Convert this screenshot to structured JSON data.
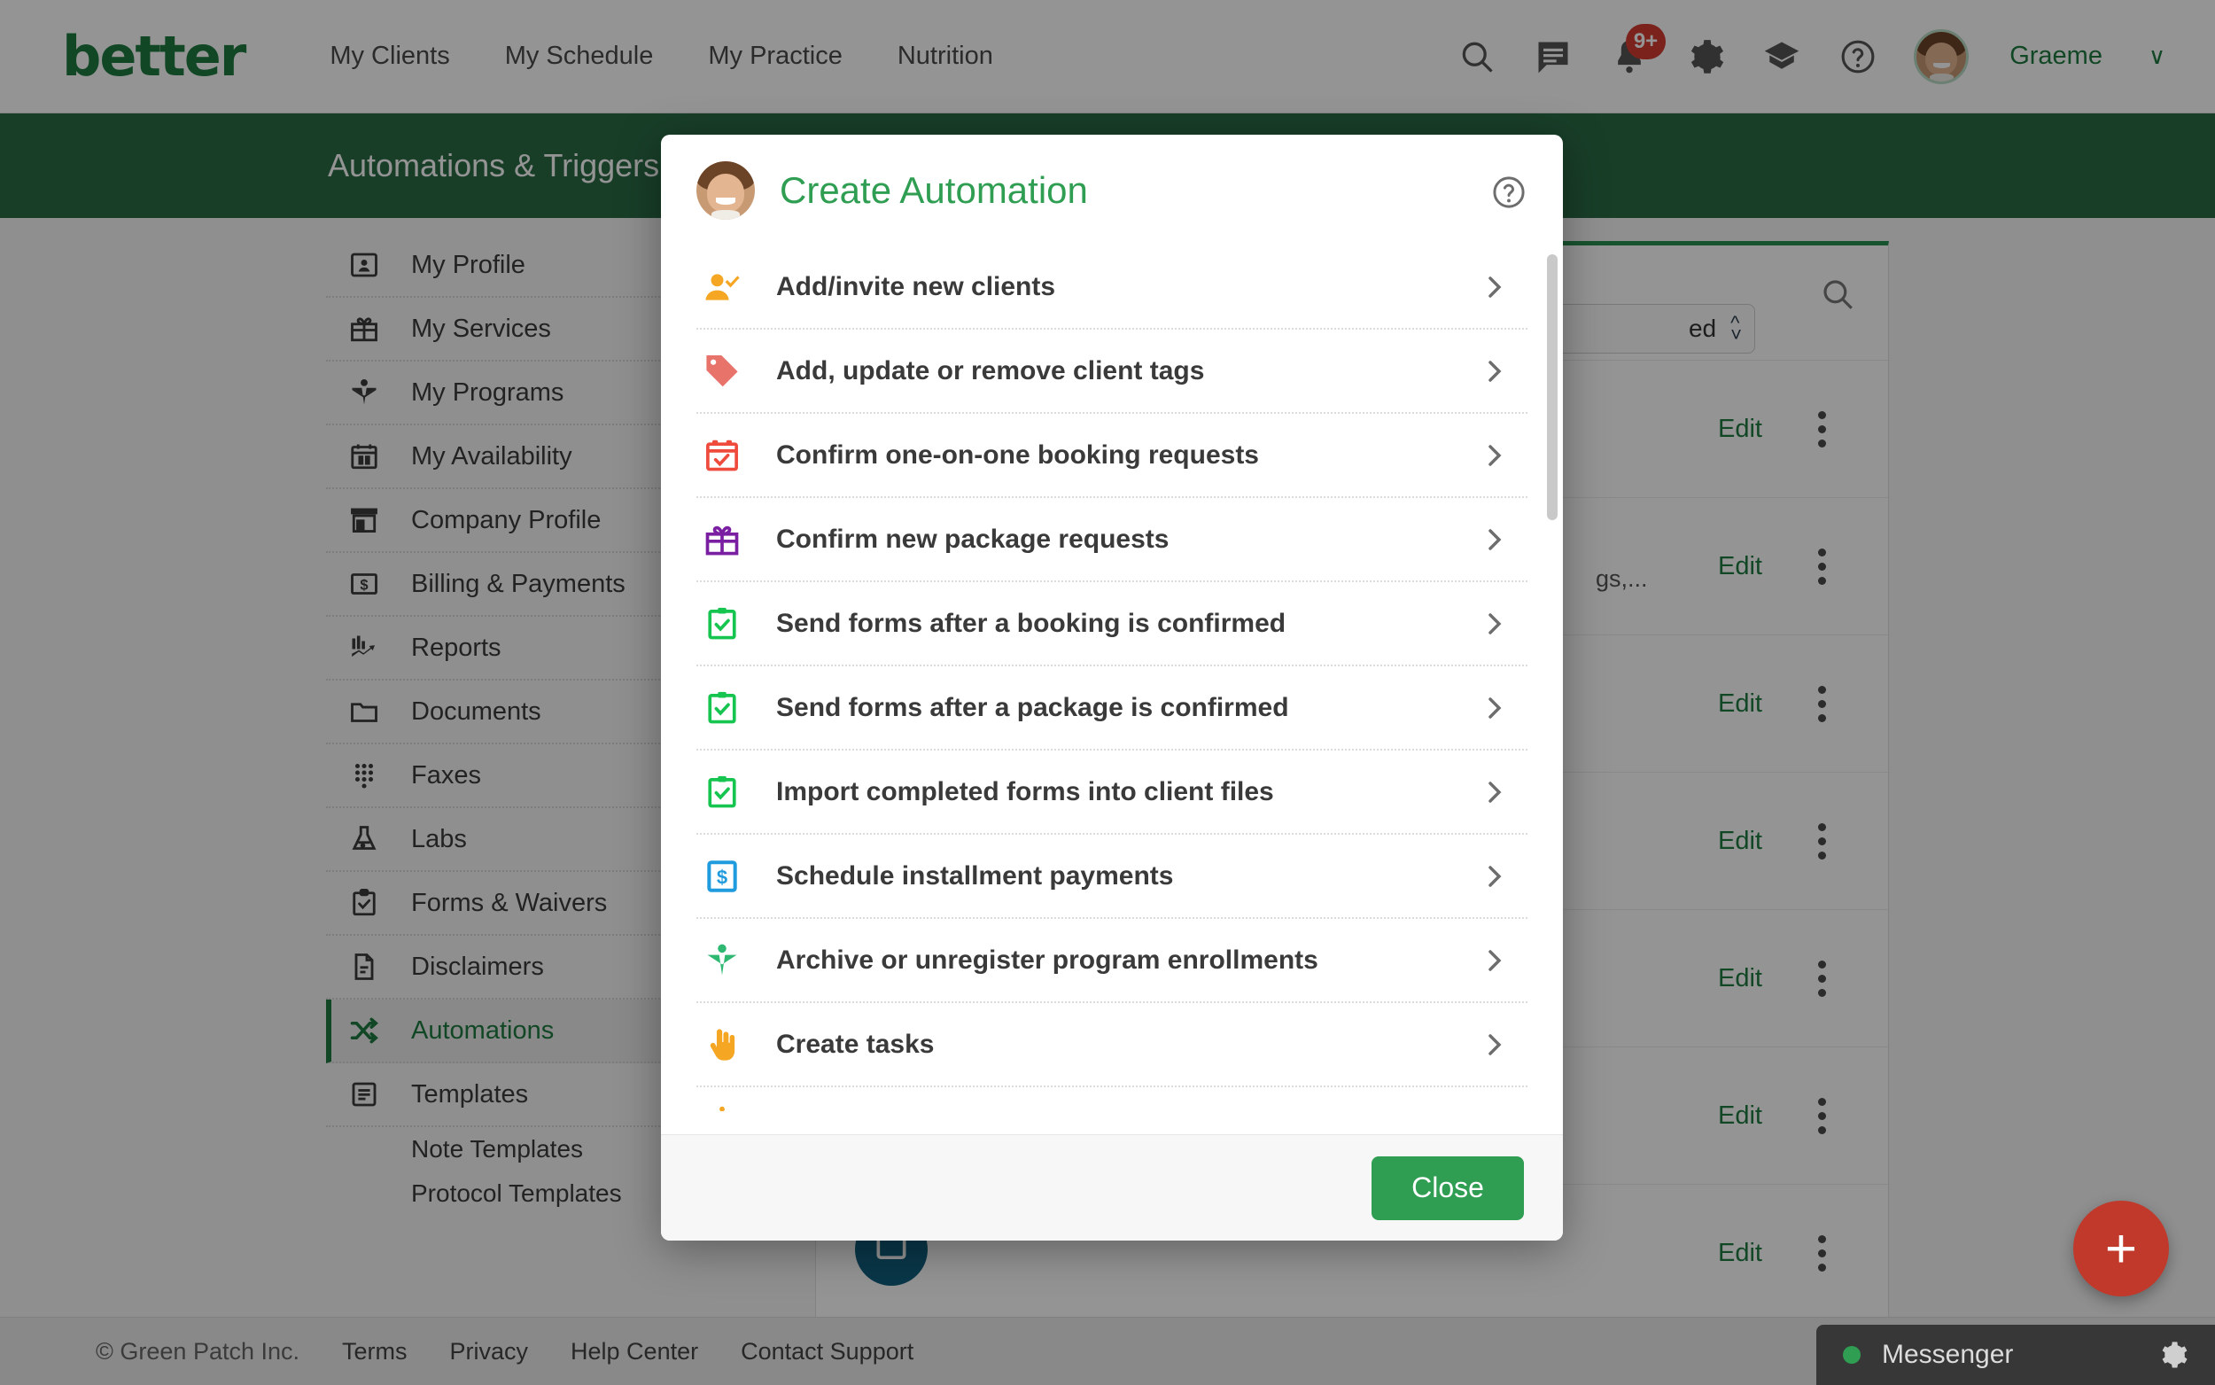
{
  "navbar": {
    "brand": "better",
    "links": [
      {
        "label": "My Clients"
      },
      {
        "label": "My Schedule"
      },
      {
        "label": "My Practice"
      },
      {
        "label": "Nutrition"
      }
    ],
    "icons": [
      {
        "name": "search-icon"
      },
      {
        "name": "message-icon"
      },
      {
        "name": "bell-icon",
        "badge": "9+"
      },
      {
        "name": "gear-icon"
      },
      {
        "name": "graduation-cap-icon"
      },
      {
        "name": "help-circle-icon"
      }
    ],
    "notification_badge": "9+",
    "username": "Graeme",
    "caret": "∨"
  },
  "page_header": {
    "title": "Automations & Triggers",
    "bg": "#2a6b45"
  },
  "sidebar": {
    "items": [
      {
        "label": "My Profile",
        "icon": "profile-card-icon",
        "active": false
      },
      {
        "label": "My Services",
        "icon": "gift-icon",
        "active": false
      },
      {
        "label": "My Programs",
        "icon": "book-icon",
        "active": false
      },
      {
        "label": "My Availability",
        "icon": "calendar-icon",
        "active": false
      },
      {
        "label": "Company Profile",
        "icon": "store-icon",
        "active": false
      },
      {
        "label": "Billing & Payments",
        "icon": "dollar-card-icon",
        "active": false
      },
      {
        "label": "Reports",
        "icon": "chart-icon",
        "active": false
      },
      {
        "label": "Documents",
        "icon": "folder-icon",
        "active": false
      },
      {
        "label": "Faxes",
        "icon": "dots-grid-icon",
        "active": false
      },
      {
        "label": "Labs",
        "icon": "flask-icon",
        "active": false
      },
      {
        "label": "Forms & Waivers",
        "icon": "clipboard-check-icon",
        "active": false
      },
      {
        "label": "Disclaimers",
        "icon": "document-icon",
        "active": false
      },
      {
        "label": "Automations",
        "icon": "shuffle-icon",
        "active": true
      },
      {
        "label": "Templates",
        "icon": "list-icon",
        "active": false
      }
    ],
    "subitems": [
      {
        "label": "Note Templates"
      },
      {
        "label": "Protocol Templates"
      }
    ]
  },
  "content": {
    "select_value": "ed",
    "search_icon": "search-icon",
    "rows": [
      {
        "edit": "Edit",
        "sub": ""
      },
      {
        "edit": "Edit",
        "sub": "gs,..."
      },
      {
        "edit": "Edit",
        "sub": ""
      },
      {
        "edit": "Edit",
        "sub": ""
      },
      {
        "edit": "Edit",
        "sub": ""
      },
      {
        "edit": "Edit",
        "sub": ""
      },
      {
        "edit": "Edit",
        "sub": ""
      }
    ],
    "fab_label": "+"
  },
  "modal": {
    "title": "Create Automation",
    "help_icon": "help-circle-icon",
    "avatar": "user-avatar",
    "items": [
      {
        "label": "Add/invite new clients",
        "icon": "user-check-icon",
        "color": "#f5a623"
      },
      {
        "label": "Add, update or remove client tags",
        "icon": "tag-icon",
        "color": "#e8736b"
      },
      {
        "label": "Confirm one-on-one booking requests",
        "icon": "calendar-check-icon",
        "color": "#ef4b3c"
      },
      {
        "label": "Confirm new package requests",
        "icon": "gift-icon",
        "color": "#7a1fa2"
      },
      {
        "label": "Send forms after a booking is confirmed",
        "icon": "clipboard-check-icon",
        "color": "#16c450"
      },
      {
        "label": "Send forms after a package is confirmed",
        "icon": "clipboard-check-icon",
        "color": "#16c450"
      },
      {
        "label": "Import completed forms into client files",
        "icon": "clipboard-check-icon",
        "color": "#16c450"
      },
      {
        "label": "Schedule installment payments",
        "icon": "dollar-card-icon",
        "color": "#1f9bde"
      },
      {
        "label": "Archive or unregister program enrollments",
        "icon": "book-icon",
        "color": "#2eb872"
      },
      {
        "label": "Create tasks",
        "icon": "hand-pointer-icon",
        "color": "#f5a623"
      }
    ],
    "close_label": "Close"
  },
  "footer": {
    "copyright": "© Green Patch Inc.",
    "links": [
      {
        "label": "Terms"
      },
      {
        "label": "Privacy"
      },
      {
        "label": "Help Center"
      },
      {
        "label": "Contact Support"
      }
    ]
  },
  "messenger": {
    "label": "Messenger",
    "status": "online",
    "gear": "gear-icon"
  },
  "colors": {
    "brand_green": "#1e7b41",
    "header_green": "#2a6b45",
    "accent_green": "#2f9e52",
    "fab_red": "#c0392b",
    "badge_red": "#d33c2f"
  }
}
